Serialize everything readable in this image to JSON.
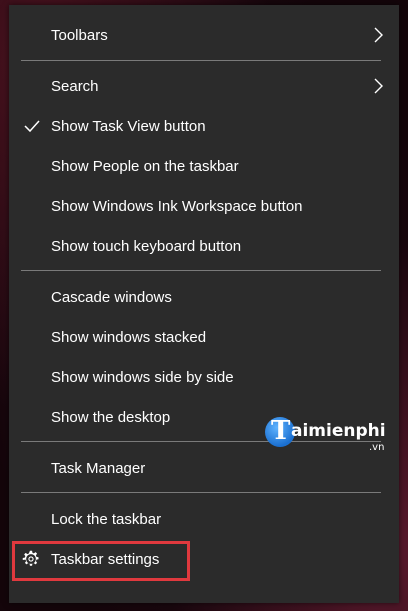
{
  "menu": {
    "items": [
      {
        "label": "Toolbars",
        "submenu": true
      },
      {
        "label": "Search",
        "submenu": true
      },
      {
        "label": "Show Task View button",
        "checked": true
      },
      {
        "label": "Show People on the taskbar"
      },
      {
        "label": "Show Windows Ink Workspace button"
      },
      {
        "label": "Show touch keyboard button"
      },
      {
        "label": "Cascade windows"
      },
      {
        "label": "Show windows stacked"
      },
      {
        "label": "Show windows side by side"
      },
      {
        "label": "Show the desktop"
      },
      {
        "label": "Task Manager"
      },
      {
        "label": "Lock the taskbar"
      },
      {
        "label": "Taskbar settings",
        "icon": "gear-icon",
        "highlighted": true
      }
    ]
  },
  "watermark": {
    "brand": "aimienphi",
    "letter": "T",
    "suffix": ".vn"
  },
  "colors": {
    "menu_bg": "#2b2b2b",
    "text": "#ffffff",
    "separator": "#7a7a7a",
    "highlight_border": "#e0393e"
  }
}
